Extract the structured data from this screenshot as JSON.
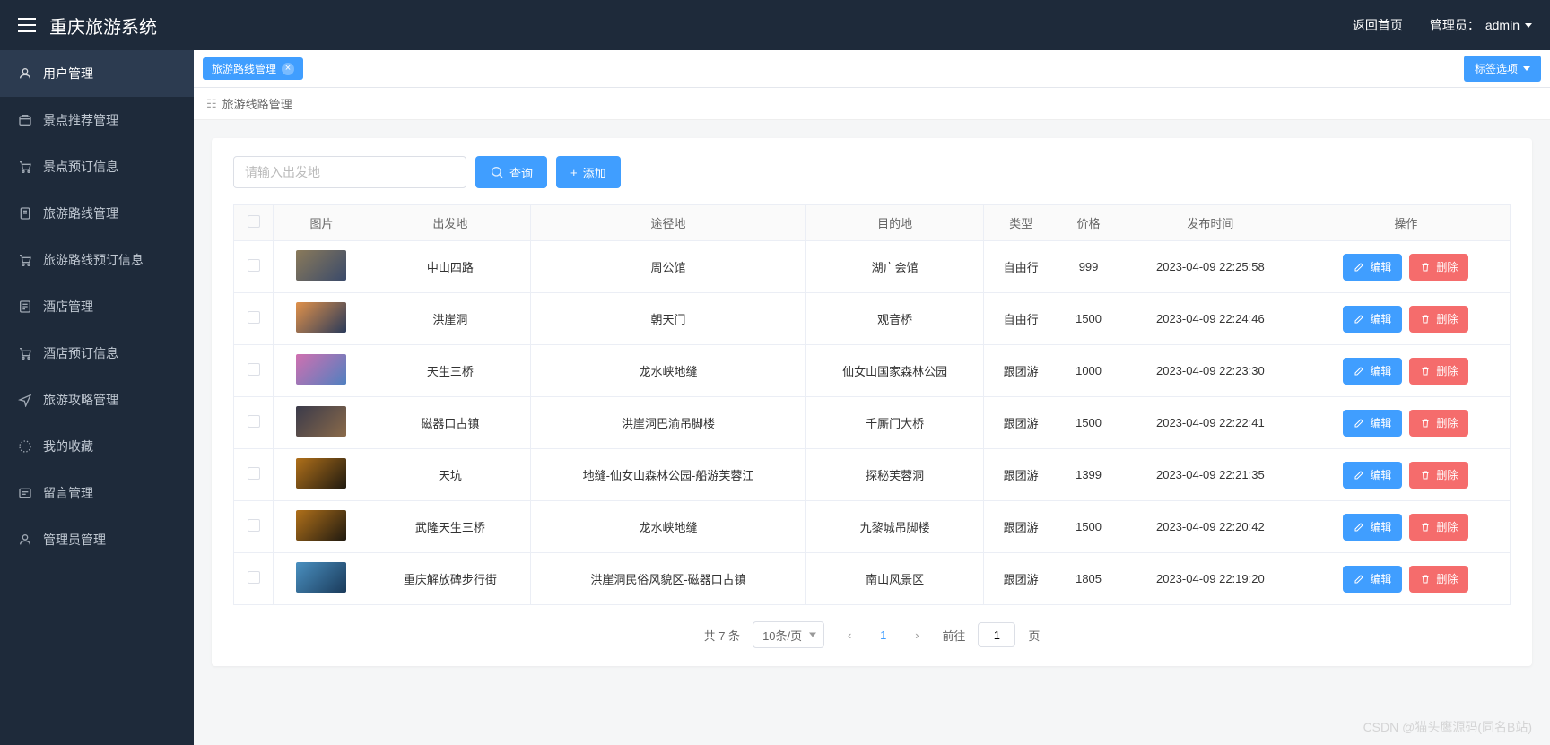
{
  "header": {
    "title": "重庆旅游系统",
    "home_link": "返回首页",
    "admin_label": "管理员：",
    "admin_name": "admin"
  },
  "sidebar": {
    "items": [
      {
        "label": "用户管理"
      },
      {
        "label": "景点推荐管理"
      },
      {
        "label": "景点预订信息"
      },
      {
        "label": "旅游路线管理"
      },
      {
        "label": "旅游路线预订信息"
      },
      {
        "label": "酒店管理"
      },
      {
        "label": "酒店预订信息"
      },
      {
        "label": "旅游攻略管理"
      },
      {
        "label": "我的收藏"
      },
      {
        "label": "留言管理"
      },
      {
        "label": "管理员管理"
      }
    ]
  },
  "tabs": {
    "active": "旅游路线管理",
    "options_label": "标签选项"
  },
  "breadcrumb": {
    "label": "旅游线路管理"
  },
  "toolbar": {
    "search_placeholder": "请输入出发地",
    "query_label": "查询",
    "add_label": "添加"
  },
  "table": {
    "headers": [
      "图片",
      "出发地",
      "途径地",
      "目的地",
      "类型",
      "价格",
      "发布时间",
      "操作"
    ],
    "edit_label": "编辑",
    "delete_label": "删除",
    "rows": [
      {
        "thumb": "linear-gradient(135deg,#8a7a5a,#3a4a6a)",
        "from": "中山四路",
        "via": "周公馆",
        "to": "湖广会馆",
        "type": "自由行",
        "price": "999",
        "time": "2023-04-09 22:25:58"
      },
      {
        "thumb": "linear-gradient(135deg,#e0914a,#2a3a5a)",
        "from": "洪崖洞",
        "via": "朝天门",
        "to": "观音桥",
        "type": "自由行",
        "price": "1500",
        "time": "2023-04-09 22:24:46"
      },
      {
        "thumb": "linear-gradient(135deg,#d070b0,#5080c0)",
        "from": "天生三桥",
        "via": "龙水峡地缝",
        "to": "仙女山国家森林公园",
        "type": "跟团游",
        "price": "1000",
        "time": "2023-04-09 22:23:30"
      },
      {
        "thumb": "linear-gradient(135deg,#3a3a4a,#8a6a4a)",
        "from": "磁器口古镇",
        "via": "洪崖洞巴渝吊脚楼",
        "to": "千厮门大桥",
        "type": "跟团游",
        "price": "1500",
        "time": "2023-04-09 22:22:41"
      },
      {
        "thumb": "linear-gradient(135deg,#b0701a,#201a10)",
        "from": "天坑",
        "via": "地缝-仙女山森林公园-船游芙蓉江",
        "to": "探秘芙蓉洞",
        "type": "跟团游",
        "price": "1399",
        "time": "2023-04-09 22:21:35"
      },
      {
        "thumb": "linear-gradient(135deg,#b0701a,#201a10)",
        "from": "武隆天生三桥",
        "via": "龙水峡地缝",
        "to": "九黎城吊脚楼",
        "type": "跟团游",
        "price": "1500",
        "time": "2023-04-09 22:20:42"
      },
      {
        "thumb": "linear-gradient(135deg,#4a90c0,#1a3a5a)",
        "from": "重庆解放碑步行街",
        "via": "洪崖洞民俗风貌区-磁器口古镇",
        "to": "南山风景区",
        "type": "跟团游",
        "price": "1805",
        "time": "2023-04-09 22:19:20"
      }
    ]
  },
  "pagination": {
    "total_label": "共 7 条",
    "page_size_label": "10条/页",
    "current_page": "1",
    "goto_label": "前往",
    "goto_value": "1",
    "page_suffix": "页"
  },
  "watermark": "CSDN @猫头鹰源码(同名B站)"
}
